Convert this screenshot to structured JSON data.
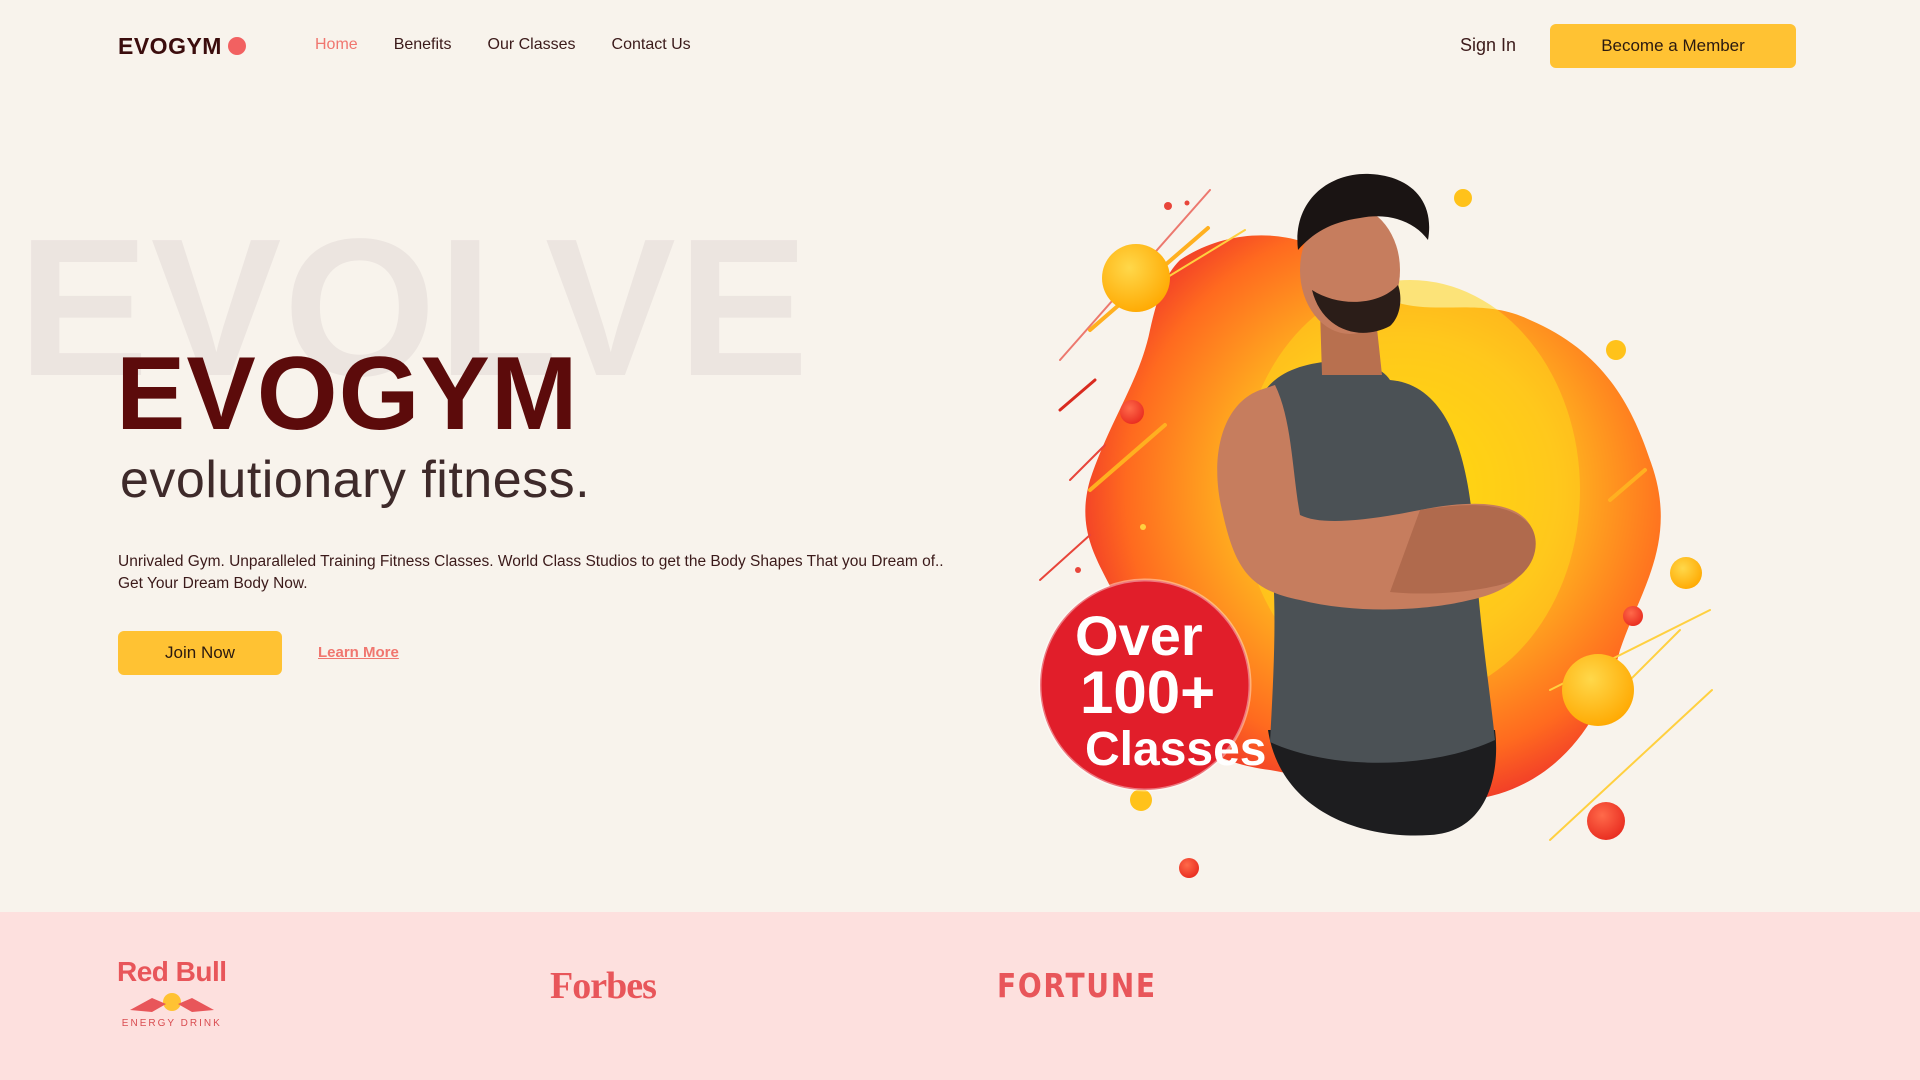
{
  "nav": {
    "logo": "EVOGYM",
    "links": [
      "Home",
      "Benefits",
      "Our Classes",
      "Contact Us"
    ],
    "active": "Home",
    "sign_in": "Sign In",
    "cta": "Become a Member"
  },
  "hero": {
    "background_word": "EVOLVE",
    "title": "EVOGYM",
    "subtitle": "evolutionary fitness.",
    "description": "Unrivaled Gym. Unparalleled Training Fitness Classes. World Class Studios to get the Body Shapes That you Dream of.. Get Your Dream Body Now.",
    "join_button": "Join Now",
    "learn_more": "Learn More"
  },
  "illustration": {
    "badge_line1": "Over",
    "badge_line2": "100+",
    "badge_line3": "Classes"
  },
  "sponsors": {
    "redbull": "Red Bull",
    "redbull_sub": "ENERGY DRINK",
    "forbes": "Forbes",
    "fortune": "FORTUNE"
  },
  "colors": {
    "background": "#f8f3ec",
    "accent_yellow": "#ffc233",
    "accent_coral": "#f0766f",
    "title_maroon": "#5c0b0b",
    "sponsor_band": "#fde0de",
    "sponsor_red": "#e8565a"
  }
}
